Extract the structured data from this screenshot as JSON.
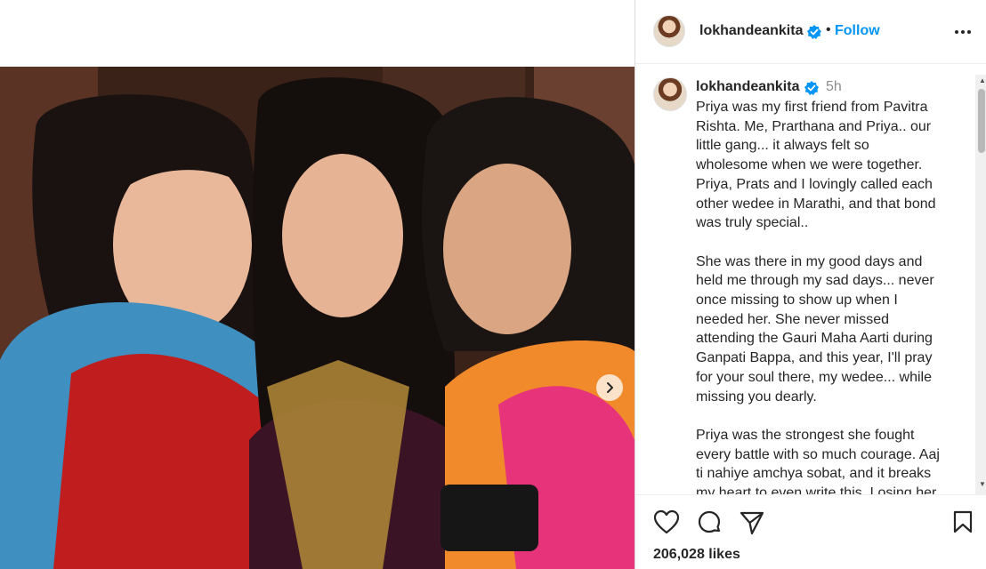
{
  "post": {
    "username": "lokhandeankita",
    "follow_label": "Follow",
    "separator": "•",
    "time": "5h",
    "caption": "Priya was my first friend from Pavitra\nRishta. Me, Prarthana and Priya.. our\nlittle gang... it always felt so\nwholesome when we were together.\nPriya, Prats and I lovingly called each\nother wedee in Marathi, and that bond\nwas truly special..\n\nShe was there in my good days and\nheld me through my sad days... never\nonce missing to show up when I\nneeded her. She never missed\nattending the Gauri Maha Aarti during\nGanpati Bappa, and this year, I'll pray\nfor your soul there, my wedee... while\nmissing you dearly.\n\nPriya was the strongest she fought\nevery battle with so much courage. Aaj\nti nahiye amchya sobat, and it breaks\nmy heart to even write this. Losing her",
    "likes": "206,028 likes"
  },
  "icons": {
    "verified": "verified-badge-icon",
    "more": "more-options-icon",
    "next": "chevron-right-icon",
    "like": "heart-icon",
    "comment": "comment-icon",
    "share": "share-icon",
    "save": "bookmark-icon"
  },
  "colors": {
    "accent": "#0095f6",
    "text": "#262626",
    "muted": "#8e8e8e"
  }
}
